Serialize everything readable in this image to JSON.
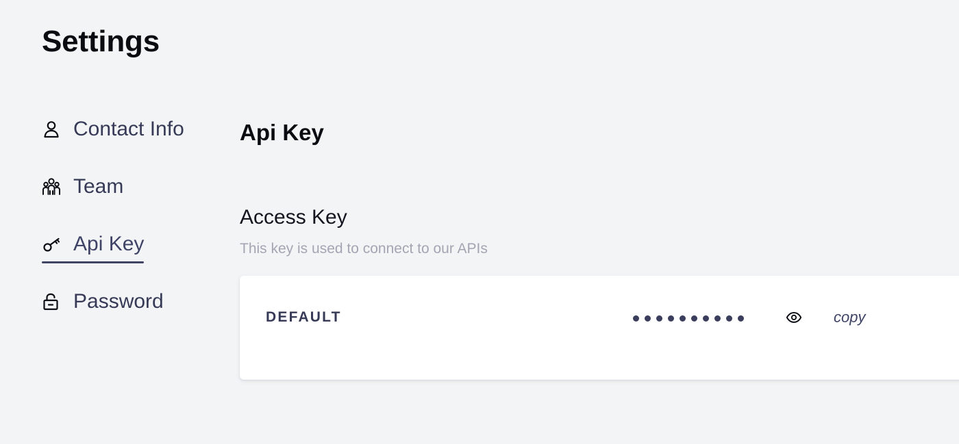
{
  "page": {
    "title": "Settings"
  },
  "sidebar": {
    "items": [
      {
        "label": "Contact Info",
        "icon": "person-icon",
        "active": false
      },
      {
        "label": "Team",
        "icon": "team-icon",
        "active": false
      },
      {
        "label": "Api Key",
        "icon": "key-icon",
        "active": true
      },
      {
        "label": "Password",
        "icon": "lock-icon",
        "active": false
      }
    ]
  },
  "main": {
    "section_title": "Api Key",
    "access_key": {
      "title": "Access Key",
      "description": "This key is used to connect to our APIs",
      "keys": [
        {
          "name": "DEFAULT",
          "masked_value": "••••••••••",
          "reveal_icon": "eye-icon",
          "copy_label": "copy"
        }
      ]
    }
  },
  "colors": {
    "background": "#f3f4f6",
    "card": "#ffffff",
    "nav_text": "#363a56",
    "active_underline": "#3f4366",
    "description_text": "#a3a5b2"
  }
}
